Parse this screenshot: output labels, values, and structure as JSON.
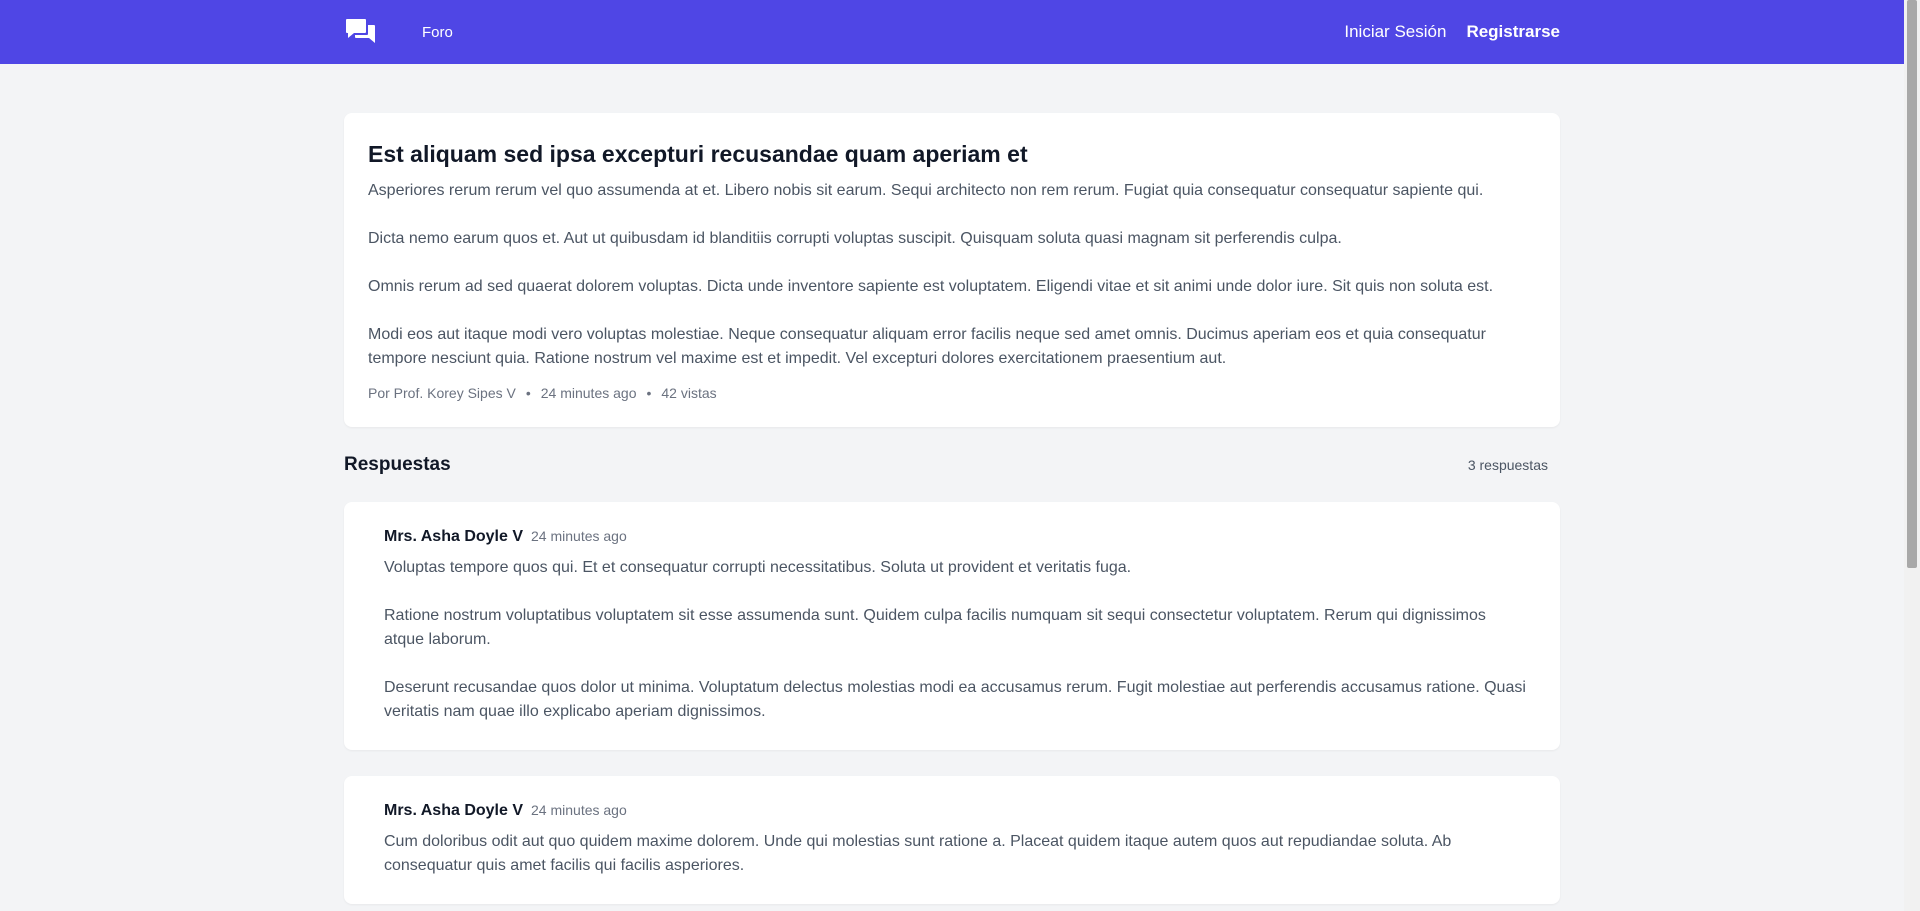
{
  "nav": {
    "forum_label": "Foro",
    "login_label": "Iniciar Sesión",
    "register_label": "Registrarse"
  },
  "post": {
    "title": "Est aliquam sed ipsa excepturi recusandae quam aperiam et",
    "paragraphs": [
      "Asperiores rerum rerum vel quo assumenda at et. Libero nobis sit earum. Sequi architecto non rem rerum. Fugiat quia consequatur consequatur sapiente qui.",
      "Dicta nemo earum quos et. Aut ut quibusdam id blanditiis corrupti voluptas suscipit. Quisquam soluta quasi magnam sit perferendis culpa.",
      "Omnis rerum ad sed quaerat dolorem voluptas. Dicta unde inventore sapiente est voluptatem. Eligendi vitae et sit animi unde dolor iure. Sit quis non soluta est.",
      "Modi eos aut itaque modi vero voluptas molestiae. Neque consequatur aliquam error facilis neque sed amet omnis. Ducimus aperiam eos et quia consequatur tempore nesciunt quia. Ratione nostrum vel maxime est et impedit. Vel excepturi dolores exercitationem praesentium aut."
    ],
    "author": "Por Prof. Korey Sipes V",
    "time": "24 minutes ago",
    "views": "42 vistas",
    "separator": "•"
  },
  "answers": {
    "title": "Respuestas",
    "count": "3 respuestas",
    "items": [
      {
        "author": "Mrs. Asha Doyle V",
        "time": "24 minutes ago",
        "paragraphs": [
          "Voluptas tempore quos qui. Et et consequatur corrupti necessitatibus. Soluta ut provident et veritatis fuga.",
          "Ratione nostrum voluptatibus voluptatem sit esse assumenda sunt. Quidem culpa facilis numquam sit sequi consectetur voluptatem. Rerum qui dignissimos atque laborum.",
          "Deserunt recusandae quos dolor ut minima. Voluptatum delectus molestias modi ea accusamus rerum. Fugit molestiae aut perferendis accusamus ratione. Quasi veritatis nam quae illo explicabo aperiam dignissimos."
        ]
      },
      {
        "author": "Mrs. Asha Doyle V",
        "time": "24 minutes ago",
        "paragraphs": [
          "Cum doloribus odit aut quo quidem maxime dolorem. Unde qui molestias sunt ratione a. Placeat quidem itaque autem quos aut repudiandae soluta. Ab consequatur quis amet facilis qui facilis asperiores."
        ]
      }
    ]
  },
  "colors": {
    "brand": "#4f46e5",
    "background": "#f3f4f6",
    "card": "#ffffff",
    "heading": "#111827",
    "text": "#4b5563",
    "muted": "#6b7280"
  },
  "icons": {
    "logo": "chat-bubbles-icon"
  }
}
